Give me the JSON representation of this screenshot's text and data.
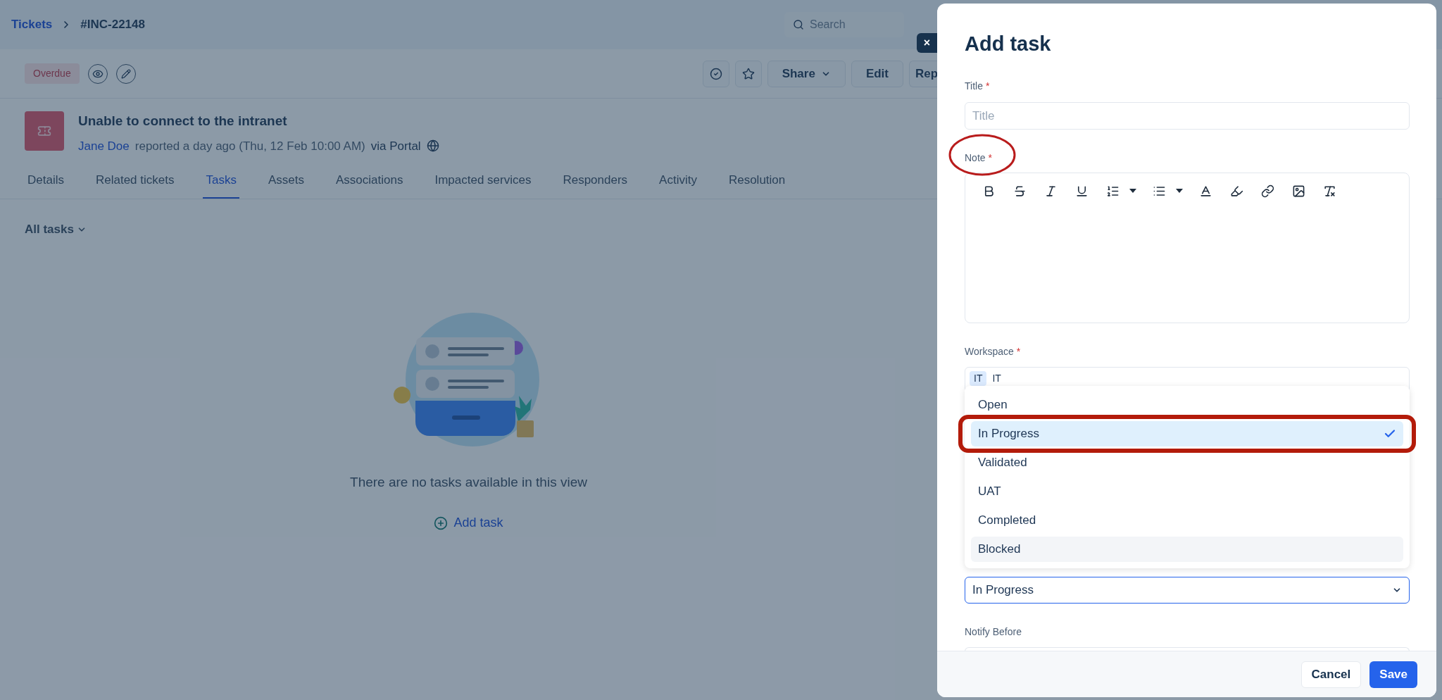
{
  "breadcrumb": [
    {
      "label": "Tickets",
      "kind": "link"
    },
    {
      "label": "#INC-22148",
      "kind": "current"
    }
  ],
  "search": {
    "placeholder": "Search"
  },
  "close_label": "×",
  "ticket": {
    "badge": "Overdue",
    "title": "Unable to connect to the intranet",
    "reporter": "Jane Doe",
    "meta": "reported a day ago (Thu, 12 Feb 10:00 AM)",
    "via": "via Portal"
  },
  "actions": [
    {
      "label": "Share",
      "dropdown": true
    },
    {
      "label": "Edit",
      "dropdown": false
    },
    {
      "label": "Rep"
    }
  ],
  "tabs": [
    {
      "label": "Details",
      "selected": false
    },
    {
      "label": "Related tickets",
      "selected": false
    },
    {
      "label": "Tasks",
      "selected": true
    },
    {
      "label": "Assets",
      "selected": false
    },
    {
      "label": "Associations",
      "selected": false
    },
    {
      "label": "Impacted services",
      "selected": false
    },
    {
      "label": "Responders",
      "selected": false
    },
    {
      "label": "Activity",
      "selected": false
    },
    {
      "label": "Resolution",
      "selected": false
    }
  ],
  "filter": "All tasks",
  "empty": {
    "message": "There are no tasks available in this view",
    "action": "Add task"
  },
  "panel": {
    "title": "Add task",
    "required_mark": "*",
    "title_field": {
      "label": "Title",
      "required": true,
      "placeholder": "Title"
    },
    "note_field": {
      "label": "Note",
      "required": true
    },
    "workspace_field": {
      "label": "Workspace",
      "required": true,
      "chip": "IT",
      "value": "IT"
    },
    "status_field": {
      "value": "In Progress",
      "options": [
        {
          "label": "Open",
          "selected": false,
          "hovered": false
        },
        {
          "label": "In Progress",
          "selected": true,
          "hovered": false
        },
        {
          "label": "Validated",
          "selected": false,
          "hovered": false
        },
        {
          "label": "UAT",
          "selected": false,
          "hovered": false
        },
        {
          "label": "Completed",
          "selected": false,
          "hovered": false
        },
        {
          "label": "Blocked",
          "selected": false,
          "hovered": true
        }
      ]
    },
    "notify_field": {
      "label": "Notify Before",
      "required": false
    },
    "buttons": [
      {
        "label": "Cancel",
        "kind": "secondary"
      },
      {
        "label": "Save",
        "kind": "primary"
      }
    ]
  }
}
